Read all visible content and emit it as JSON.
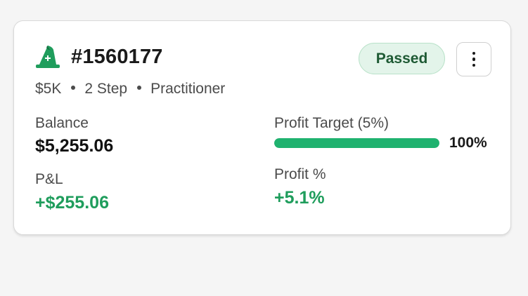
{
  "account": {
    "id": "#1560177",
    "size": "$5K",
    "steps": "2 Step",
    "tier": "Practitioner",
    "status": "Passed",
    "brand_color": "#1f9d5c"
  },
  "icons": {
    "logo": "wizard-hat-icon",
    "menu": "more-vertical-icon"
  },
  "stats": {
    "balance_label": "Balance",
    "balance_value": "$5,255.06",
    "pnl_label": "P&L",
    "pnl_value": "+$255.06",
    "profit_target_label": "Profit Target (5%)",
    "profit_target_progress": 1.0,
    "profit_target_progress_text": "100%",
    "profit_pct_label": "Profit %",
    "profit_pct_value": "+5.1%"
  }
}
